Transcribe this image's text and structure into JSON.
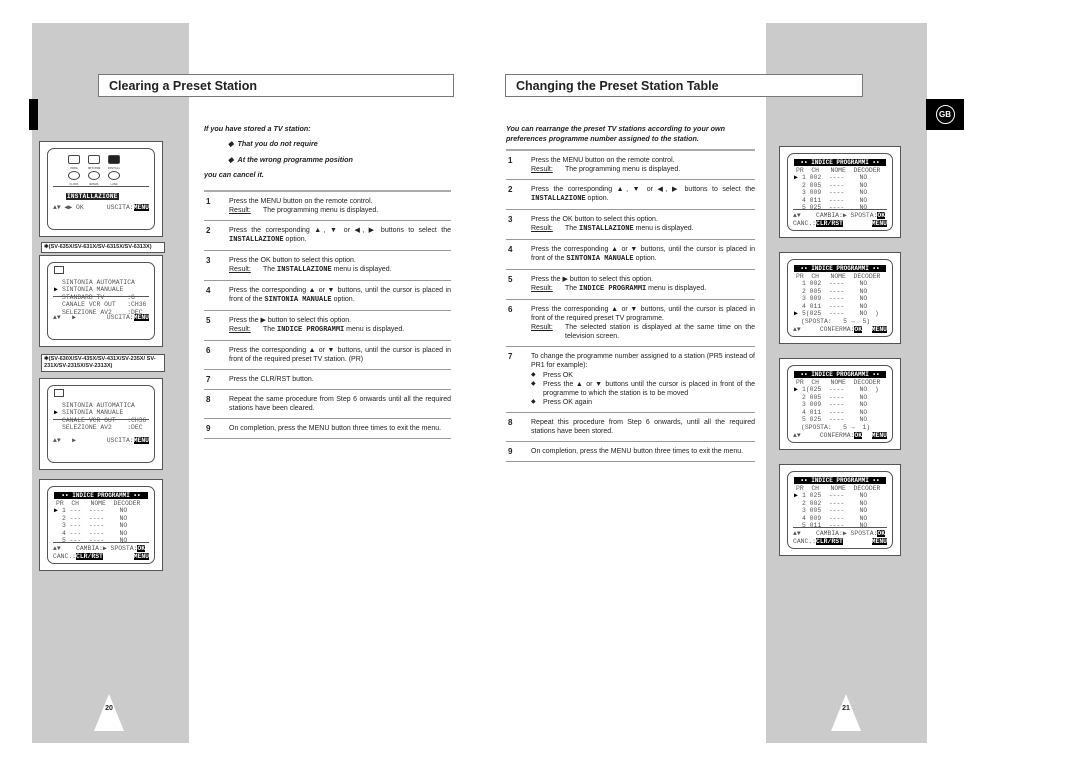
{
  "badge": "GB",
  "page_left": {
    "title": "Clearing a Preset Station",
    "page_number": "20",
    "intro": "If you have stored a TV station:",
    "bullets": [
      "That you do not require",
      "At the wrong programme position"
    ],
    "outro": "you can cancel it.",
    "steps": [
      {
        "n": "1",
        "text": "Press the MENU button on the remote control.",
        "result": "The programming menu is displayed."
      },
      {
        "n": "2",
        "pre": "Press the corresponding ▲, ▼ or ◀, ▶ buttons to select the ",
        "mono": "INSTALLAZIONE",
        "post": " option."
      },
      {
        "n": "3",
        "text": "Press the OK button to select this option.",
        "result_pre": "The ",
        "result_mono": "INSTALLAZIONE",
        "result_post": " menu is displayed."
      },
      {
        "n": "4",
        "pre": "Press the corresponding ▲ or ▼ buttons, until the cursor is placed in front of the ",
        "mono": "SINTONIA MANUALE",
        "post": " option."
      },
      {
        "n": "5",
        "text": "Press the ▶ button to select this option.",
        "result_pre": "The ",
        "result_mono": "INDICE PROGRAMMI",
        "result_post": " menu is displayed."
      },
      {
        "n": "6",
        "text": "Press the corresponding ▲ or ▼ buttons, until the cursor is placed in front of the required preset TV station. (PR)"
      },
      {
        "n": "7",
        "text": "Press the CLR/RST button."
      },
      {
        "n": "8",
        "text": "Repeat the same procedure from Step 6 onwards until all the required stations have been cleared."
      },
      {
        "n": "9",
        "text": "On completion, press the MENU button three times to exit the menu."
      }
    ],
    "result_label": "Result:",
    "screens": {
      "menu": {
        "icons": [
          "PROG",
          "OPTIONS",
          "INSTALL",
          "CLOCK",
          "BONUS",
          "LANG"
        ],
        "selected": "INSTALLAZIONE",
        "footer_left": "▲▼ ◀▶ OK",
        "footer_exit": "USCITA:",
        "footer_key": "MENU"
      },
      "model_a": "✱(SV-635X/SV-631X/SV-6315X/SV-6313X)",
      "install_a": {
        "icon_label": "INSTALL",
        "rows": [
          "SINTONIA AUTOMATICA",
          "SINTONIA MANUALE",
          "STANDARD TV      :G",
          "CANALE VCR OUT   :CH36",
          "SELEZIONE AV2    :DEC"
        ],
        "cursor_row": 1,
        "footer_left": "▲▼   ▶",
        "footer_exit": "USCITA:",
        "footer_key": "MENU"
      },
      "model_b": "✱(SV-630X/SV-435X/SV-431X/SV-235X/ SV-231X/SV-2315X/SV-2313X)",
      "install_b": {
        "icon_label": "INSTALL",
        "rows": [
          "SINTONIA AUTOMATICA",
          "SINTONIA MANUALE",
          "CANALE VCR OUT   :CH36",
          "SELEZIONE AV2    :DEC"
        ],
        "cursor_row": 1,
        "footer_left": "▲▼   ▶",
        "footer_exit": "USCITA:",
        "footer_key": "MENU"
      },
      "index": {
        "title": "•• INDICE PROGRAMMI ••",
        "header": "PR  CH   NOME  DECODER",
        "rows": [
          "1 ---  ----    NO",
          "2 ---  ----    NO",
          "3 ---  ----    NO",
          "4 ---  ----    NO",
          "5 ---  ----    NO"
        ],
        "cursor_row": 0,
        "foot1_left": "▲▼    CAMBIA:▶ SPOSTA:",
        "foot1_key": "OK",
        "foot2_left": "CANC.:",
        "foot2_key": "CLR/RST",
        "foot2_right": "MENU"
      }
    }
  },
  "page_right": {
    "title": "Changing the Preset Station Table",
    "page_number": "21",
    "intro": "You can rearrange the preset TV stations according to your own preferences programme number assigned to the station.",
    "steps": [
      {
        "n": "1",
        "text": "Press the MENU button on the remote control.",
        "result": "The programming menu is displayed."
      },
      {
        "n": "2",
        "pre": "Press the corresponding ▲, ▼ or ◀, ▶ buttons to select the ",
        "mono": "INSTALLAZIONE",
        "post": " option."
      },
      {
        "n": "3",
        "text": "Press the OK button to select this option.",
        "result_pre": "The ",
        "result_mono": "INSTALLAZIONE",
        "result_post": " menu is displayed."
      },
      {
        "n": "4",
        "pre": "Press the corresponding ▲ or ▼ buttons, until the cursor is placed in front of the ",
        "mono": "SINTONIA MANUALE",
        "post": " option."
      },
      {
        "n": "5",
        "text": "Press the ▶ button to select this option.",
        "result_pre": "The ",
        "result_mono": "INDICE PROGRAMMI",
        "result_post": "  menu is displayed."
      },
      {
        "n": "6",
        "text": "Press the corresponding ▲ or ▼ buttons, until the cursor is placed in front of the required preset TV programme.",
        "result": "The selected station is displayed at the same time on the television screen."
      },
      {
        "n": "7",
        "text": "To change the programme number assigned to a station (PR5 instead of PR1 for example):",
        "bullets": [
          "Press OK",
          "Press the ▲ or ▼ buttons until the cursor is placed in front of the programme to which the station is to be moved",
          "Press OK again"
        ]
      },
      {
        "n": "8",
        "text": "Repeat this procedure from Step 6 onwards, until all the required stations have been stored."
      },
      {
        "n": "9",
        "text": "On completion, press the MENU button three times to exit the menu."
      }
    ],
    "result_label": "Result:",
    "screens": [
      {
        "title": "•• INDICE PROGRAMMI ••",
        "header": "PR  CH   NOME  DECODER",
        "rows": [
          "1 002  ----    NO",
          "2 005  ----    NO",
          "3 009  ----    NO",
          "4 011  ----    NO",
          "5 025  ----    NO"
        ],
        "cursor_row": 0,
        "mode": "cambia",
        "foot1_left": "▲▼    CAMBIA:▶ SPOSTA:",
        "foot1_key": "OK",
        "foot2_left": "CANC.:",
        "foot2_key": "CLR/RST",
        "foot2_right": "MENU"
      },
      {
        "title": "•• INDICE PROGRAMMI ••",
        "header": "PR  CH   NOME  DECODER",
        "rows": [
          "1 002  ----    NO",
          "2 005  ----    NO",
          "3 009  ----    NO",
          "4 011  ----    NO",
          "5(025  ----    NO  )"
        ],
        "cursor_row": 4,
        "mode": "conferma",
        "sposta": "(SPOSTA:   5 →  5)",
        "foot_left": "▲▼     CONFERMA:",
        "foot_key": "OK",
        "foot_right": "MENU"
      },
      {
        "title": "•• INDICE PROGRAMMI ••",
        "header": "PR  CH   NOME  DECODER",
        "rows": [
          "1(025  ----    NO  )",
          "2 005  ----    NO",
          "3 009  ----    NO",
          "4 011  ----    NO",
          "5 025  ----    NO"
        ],
        "cursor_row": 0,
        "mode": "conferma",
        "sposta": "(SPOSTA:   5 →  1)",
        "foot_left": "▲▼     CONFERMA:",
        "foot_key": "OK",
        "foot_right": "MENU"
      },
      {
        "title": "•• INDICE PROGRAMMI ••",
        "header": "PR  CH   NOME  DECODER",
        "rows": [
          "1 025  ----    NO",
          "2 002  ----    NO",
          "3 005  ----    NO",
          "4 009  ----    NO",
          "5 011  ----    NO"
        ],
        "cursor_row": 0,
        "mode": "cambia",
        "foot1_left": "▲▼    CAMBIA:▶ SPOSTA:",
        "foot1_key": "OK",
        "foot2_left": "CANC.:",
        "foot2_key": "CLR/RST",
        "foot2_right": "MENU"
      }
    ]
  }
}
